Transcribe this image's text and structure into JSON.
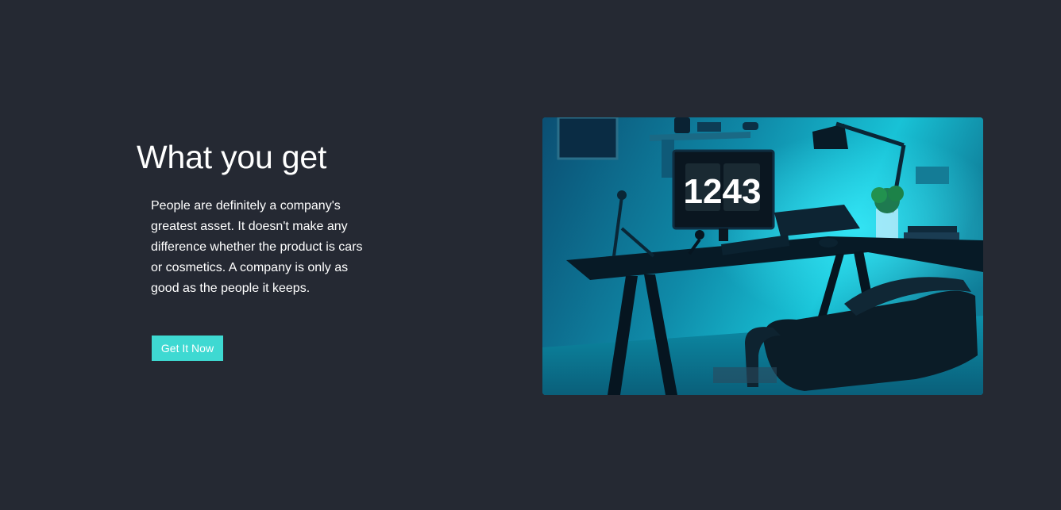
{
  "section": {
    "title": "What you get",
    "description": "People are definitely a company's greatest asset. It doesn't make any difference whether the product is cars or cosmetics. A company is only as good as the people it keeps.",
    "cta_label": "Get It Now"
  },
  "image": {
    "clock_hour": "12",
    "clock_minute": "43"
  },
  "colors": {
    "background": "#252933",
    "accent": "#3ed9d2",
    "text": "#ffffff"
  }
}
